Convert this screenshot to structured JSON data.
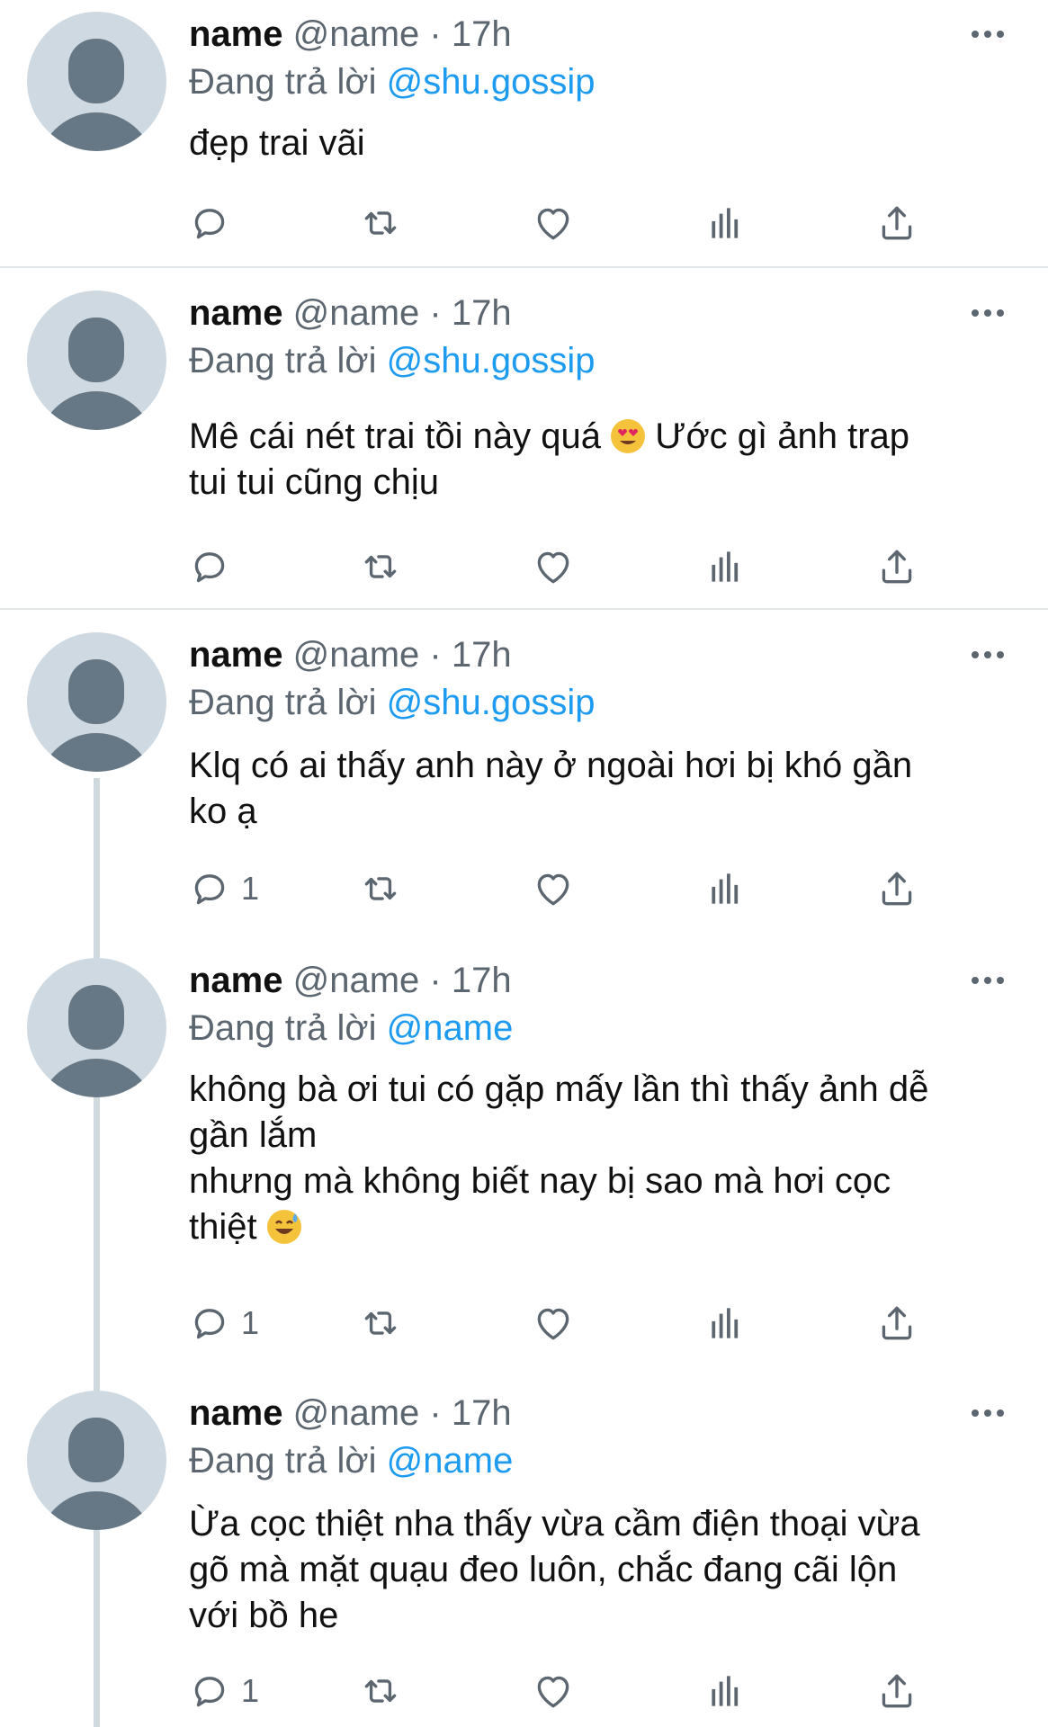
{
  "tweets": [
    {
      "name": "name",
      "handle": "@name",
      "dot": "·",
      "time": "17h",
      "reply_prefix": "Đang trả lời",
      "reply_to": "@shu.gossip",
      "text": "đẹp trai vãi",
      "reply_count": "",
      "emoji": ""
    },
    {
      "name": "name",
      "handle": "@name",
      "dot": "·",
      "time": "17h",
      "reply_prefix": "Đang trả lời",
      "reply_to": "@shu.gossip",
      "text": "Mê cái nét trai tồi này quá",
      "text2": "Ước gì ảnh trap\ntui tui cũng chịu",
      "emoji": "heart-eyes-emoji",
      "reply_count": ""
    },
    {
      "name": "name",
      "handle": "@name",
      "dot": "·",
      "time": "17h",
      "reply_prefix": "Đang trả lời",
      "reply_to": "@shu.gossip",
      "text": "Klq có ai thấy anh này ở ngoài hơi bị khó gần\nko ạ",
      "reply_count": "1",
      "emoji": ""
    },
    {
      "name": "name",
      "handle": "@name",
      "dot": "·",
      "time": "17h",
      "reply_prefix": "Đang trả lời",
      "reply_to": "@name",
      "text": "không bà ơi tui có gặp mấy lần thì thấy ảnh dễ\ngần lắm\nnhưng mà không biết nay bị sao mà hơi cọc\nthiệt",
      "emoji": "sweat-smile-emoji",
      "reply_count": "1"
    },
    {
      "name": "name",
      "handle": "@name",
      "dot": "·",
      "time": "17h",
      "reply_prefix": "Đang trả lời",
      "reply_to": "@name",
      "text": "Ừa cọc thiệt nha thấy vừa cầm điện thoại vừa\ngõ mà mặt quạu đeo luôn, chắc đang cãi lộn\nvới bồ he",
      "reply_count": "1",
      "emoji": ""
    }
  ],
  "icons": {
    "reply": "reply-icon",
    "retweet": "retweet-icon",
    "like": "like-icon",
    "views": "views-icon",
    "share": "share-icon",
    "more": "more-icon"
  },
  "colors": {
    "link": "#1d9bf0",
    "secondary": "#5b6670",
    "avatar_bg": "#cfd9e1",
    "avatar_fg": "#667785"
  }
}
